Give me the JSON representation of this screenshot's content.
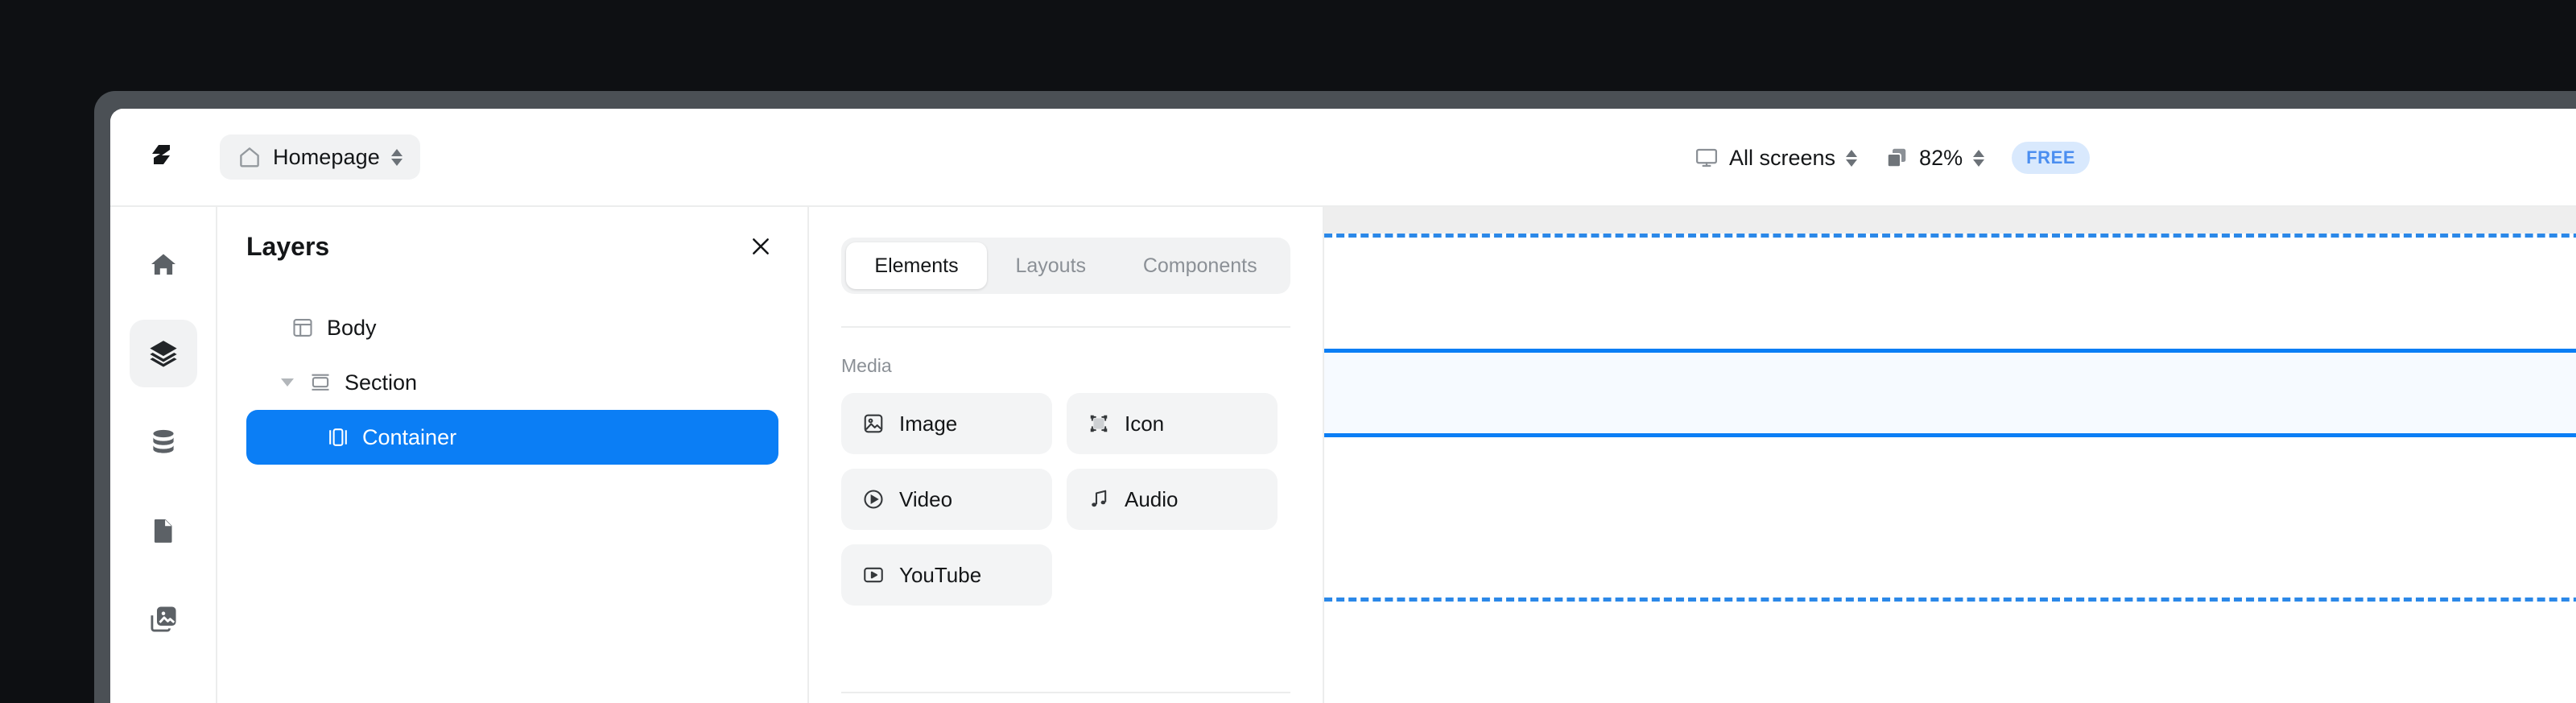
{
  "window": {
    "topbar": {
      "logo_icon": "lightning-logo-icon",
      "page_selector": {
        "icon": "home-icon",
        "label": "Homepage",
        "stepper_icon": "up-down-chevron-icon"
      },
      "screens_control": {
        "icon": "monitor-icon",
        "label": "All screens",
        "stepper_icon": "up-down-chevron-icon"
      },
      "zoom_control": {
        "icon": "layers-square-icon",
        "label": "82%",
        "stepper_icon": "up-down-chevron-icon"
      },
      "plan_badge": "FREE"
    },
    "icon_rail": {
      "items": [
        {
          "name": "home",
          "icon": "home-filled-icon",
          "active": false
        },
        {
          "name": "layers",
          "icon": "layers-stack-icon",
          "active": true
        },
        {
          "name": "data",
          "icon": "database-icon",
          "active": false
        },
        {
          "name": "pages",
          "icon": "page-file-icon",
          "active": false
        },
        {
          "name": "assets",
          "icon": "images-stack-icon",
          "active": false
        }
      ]
    },
    "layers_panel": {
      "title": "Layers",
      "close_icon": "close-x-icon",
      "tree": [
        {
          "label": "Body",
          "icon": "body-layout-icon",
          "depth": 0,
          "twisty": false,
          "selected": false
        },
        {
          "label": "Section",
          "icon": "section-icon",
          "depth": 1,
          "twisty": true,
          "selected": false
        },
        {
          "label": "Container",
          "icon": "container-icon",
          "depth": 2,
          "twisty": false,
          "selected": true
        }
      ]
    },
    "elements_panel": {
      "tabs": [
        {
          "label": "Elements",
          "active": true
        },
        {
          "label": "Layouts",
          "active": false
        },
        {
          "label": "Components",
          "active": false
        }
      ],
      "groups": [
        {
          "title": "Media",
          "cards": [
            {
              "label": "Image",
              "icon": "image-icon"
            },
            {
              "label": "Icon",
              "icon": "icon-frame-icon"
            },
            {
              "label": "Video",
              "icon": "play-circle-icon"
            },
            {
              "label": "Audio",
              "icon": "music-note-icon"
            },
            {
              "label": "YouTube",
              "icon": "youtube-play-icon"
            }
          ]
        }
      ]
    },
    "canvas": {
      "selected_element": "Container",
      "selection_color": "#0b7ef5",
      "guide_color": "#2b88e8",
      "selection_fill": "#f6faff",
      "top_strip_color": "#eeeeee"
    }
  }
}
